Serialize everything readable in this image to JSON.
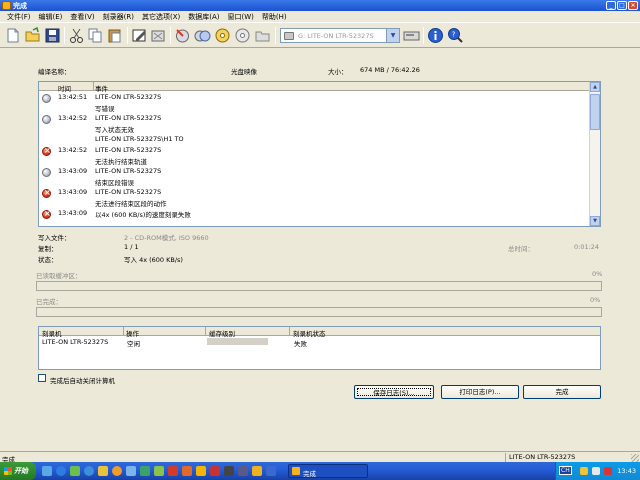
{
  "window": {
    "title": "完成"
  },
  "menu": [
    "文件(F)",
    "编辑(E)",
    "查看(V)",
    "刻录器(R)",
    "其它选项(X)",
    "数据库(A)",
    "窗口(W)",
    "帮助(H)"
  ],
  "toolbar": {
    "icons": [
      "new-icon",
      "open-icon",
      "save-icon",
      "cut-icon",
      "copy-icon",
      "paste-icon",
      "write-disc-icon",
      "erase-icon",
      "burn-icon",
      "disc-info-icon",
      "copy-disc-icon",
      "eject-icon",
      "folder-icon"
    ],
    "drive": "G: LITE-ON  LTR-52327S"
  },
  "summary": {
    "compile_name_label": "编译名称：",
    "disc_type": "光盘映像",
    "size_label": "大小：",
    "size_value": "674 MB / 76:42.26"
  },
  "log": {
    "columns": [
      "时间",
      "事件"
    ],
    "rows": [
      {
        "icon": "info",
        "time": "13:42:51",
        "lines": [
          "LITE-ON  LTR-52327S",
          "写错误"
        ]
      },
      {
        "icon": "info",
        "time": "13:42:52",
        "lines": [
          "LITE-ON  LTR-52327S",
          "写入状态无效",
          "LITE-ON LTR-52327S\\H1 TO"
        ]
      },
      {
        "icon": "err",
        "time": "13:42:52",
        "lines": [
          "LITE-ON  LTR-52327S",
          "无法执行结束轨道"
        ]
      },
      {
        "icon": "info",
        "time": "13:43:09",
        "lines": [
          "LITE-ON  LTR-52327S",
          "结束区段错误"
        ]
      },
      {
        "icon": "err",
        "time": "13:43:09",
        "lines": [
          "LITE-ON  LTR-52327S",
          "无法进行结束区段的动作"
        ]
      },
      {
        "icon": "err",
        "time": "13:43:09",
        "lines": [
          "以4x (600 KB/s)的速度刻录失败"
        ]
      }
    ]
  },
  "status": {
    "write_file_label": "写入文件：",
    "write_file_value": "2 - CD-ROM模式, ISO 9660",
    "copies_label": "复制：",
    "copies_value": "1 / 1",
    "state_label": "状态：",
    "state_value": "写入 4x (600 KB/s)",
    "elapsed_label": "总时间：",
    "elapsed_value": "0:01:24",
    "buffer_label": "已读取缓冲区：",
    "buffer_pct": "0%",
    "done_label": "已完成：",
    "done_pct": "0%"
  },
  "devices": {
    "columns": [
      "刻录机",
      "操作",
      "缓存级别",
      "刻录机状态"
    ],
    "rows": [
      {
        "name": "LITE-ON  LTR-52327S",
        "op": "空闲",
        "state": "失败"
      }
    ]
  },
  "options": {
    "shutdown_label": "完成后自动关闭计算机"
  },
  "buttons": {
    "save_log": "保存日志(S)...",
    "print_log": "打印日志(P)...",
    "finish": "完成"
  },
  "statusbar": {
    "left": "完成",
    "right": "LITE-ON  LTR-52327S"
  },
  "taskbar": {
    "start": "开始",
    "task": "完成",
    "ime": "CH",
    "clock": "13:43"
  }
}
